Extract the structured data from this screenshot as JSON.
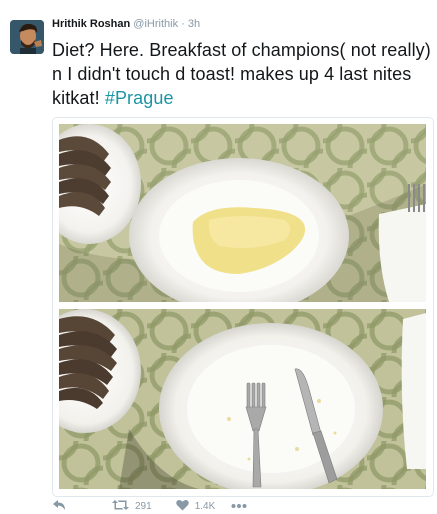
{
  "tweet": {
    "author_name": "Hrithik Roshan",
    "author_handle": "@iHrithik",
    "separator": "·",
    "timestamp": "3h",
    "text_main": "Diet? Here. Breakfast of champions( not really) n I didn't touch d toast! makes up 4 last nites kitkat! ",
    "hashtag": "#Prague",
    "media": [
      {
        "description_icon": "photo-omelette-plate"
      },
      {
        "description_icon": "photo-empty-plate-cutlery"
      }
    ],
    "actions": {
      "reply_icon": "reply-icon",
      "retweet_icon": "retweet-icon",
      "retweet_count": "291",
      "like_icon": "heart-icon",
      "like_count": "1.4K",
      "more_icon": "more-icon"
    }
  },
  "colors": {
    "name": "#14171a",
    "meta": "#8899a6",
    "hashtag": "#1b95a3",
    "border": "#e1e8ed"
  }
}
